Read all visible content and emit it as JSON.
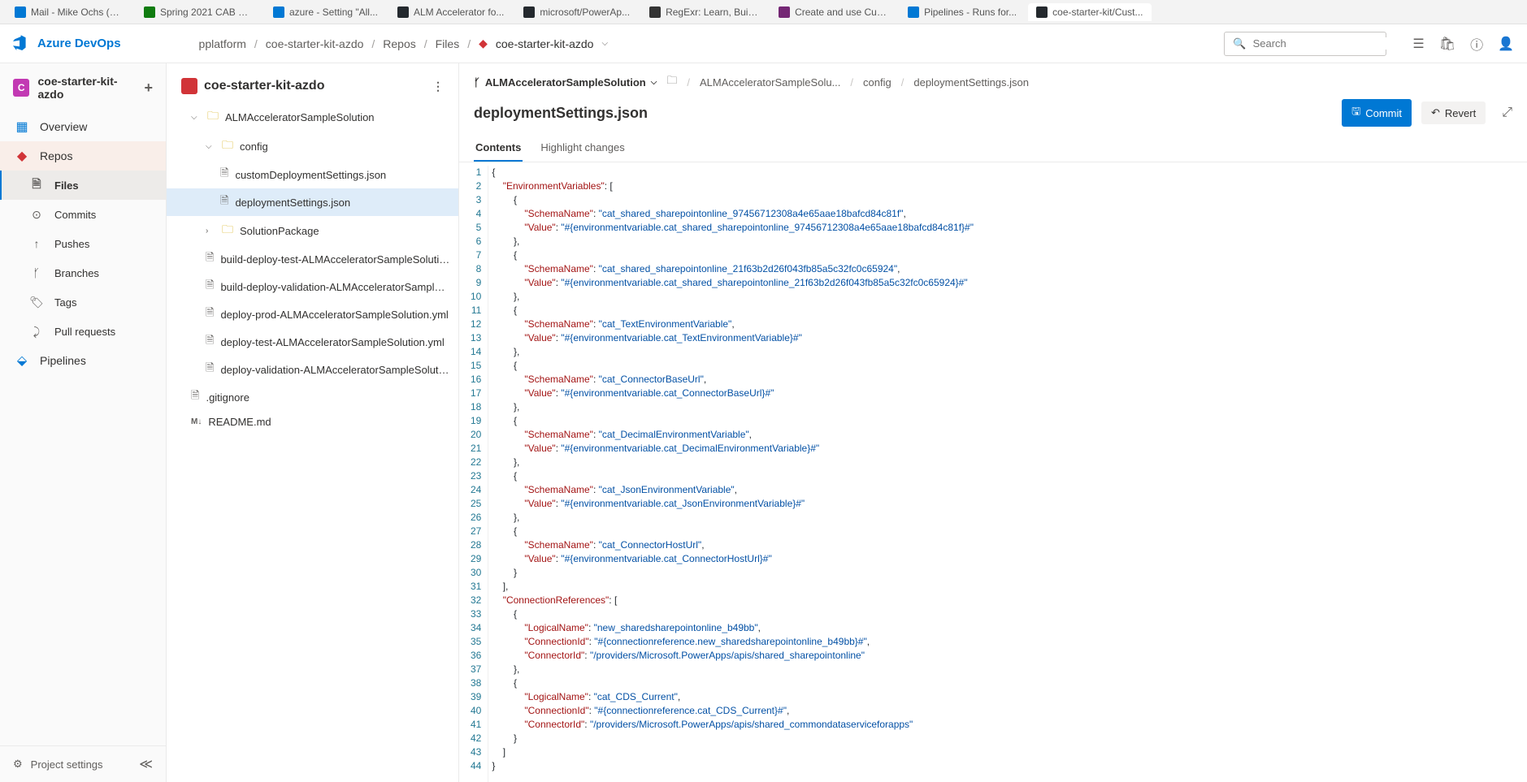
{
  "browser_tabs": [
    {
      "label": "Mail - Mike Ochs (C...",
      "favicon": "#0078d4"
    },
    {
      "label": "Spring 2021 CAB Se...",
      "favicon": "#107c10"
    },
    {
      "label": "azure - Setting \"All...",
      "favicon": "#0078d4"
    },
    {
      "label": "ALM Accelerator fo...",
      "favicon": "#24292e"
    },
    {
      "label": "microsoft/PowerAp...",
      "favicon": "#24292e"
    },
    {
      "label": "RegExr: Learn, Build...",
      "favicon": "#333"
    },
    {
      "label": "Create and use Cus...",
      "favicon": "#742774"
    },
    {
      "label": "Pipelines - Runs for...",
      "favicon": "#0078d4"
    },
    {
      "label": "coe-starter-kit/Cust...",
      "favicon": "#24292e"
    }
  ],
  "product": "Azure DevOps",
  "breadcrumbs": {
    "org": "pplatform",
    "project": "coe-starter-kit-azdo",
    "hub": "Repos",
    "sub": "Files",
    "repo": "coe-starter-kit-azdo"
  },
  "search_placeholder": "Search",
  "left_nav": {
    "project": "coe-starter-kit-azdo",
    "project_initial": "C",
    "items": [
      {
        "label": "Overview",
        "icon": "◧",
        "class": "overview"
      },
      {
        "label": "Repos",
        "icon": "◆",
        "class": "repos"
      }
    ],
    "sub_items": [
      {
        "label": "Files",
        "selected": true
      },
      {
        "label": "Commits"
      },
      {
        "label": "Pushes"
      },
      {
        "label": "Branches"
      },
      {
        "label": "Tags"
      },
      {
        "label": "Pull requests"
      }
    ],
    "pipelines": "Pipelines",
    "footer": "Project settings"
  },
  "tree": {
    "repo": "coe-starter-kit-azdo",
    "root_folder": "ALMAcceleratorSampleSolution",
    "sub_folder": "config",
    "files_in_config": [
      "customDeploymentSettings.json",
      "deploymentSettings.json"
    ],
    "solution_pkg": "SolutionPackage",
    "root_files": [
      "build-deploy-test-ALMAcceleratorSampleSolutio...",
      "build-deploy-validation-ALMAcceleratorSampleS...",
      "deploy-prod-ALMAcceleratorSampleSolution.yml",
      "deploy-test-ALMAcceleratorSampleSolution.yml",
      "deploy-validation-ALMAcceleratorSampleSolutio..."
    ],
    "gitignore": ".gitignore",
    "readme": "README.md",
    "readme_prefix": "M↓"
  },
  "file_bc": {
    "branch": "ALMAcceleratorSampleSolution",
    "path": [
      "ALMAcceleratorSampleSolu...",
      "config",
      "deploymentSettings.json"
    ]
  },
  "file_title": "deploymentSettings.json",
  "commit_btn": "Commit",
  "revert_btn": "Revert",
  "tabs": {
    "contents": "Contents",
    "highlight": "Highlight changes"
  },
  "code_lines": [
    [
      {
        "t": "p",
        "v": "{"
      }
    ],
    [
      {
        "t": "p",
        "v": "    "
      },
      {
        "t": "k",
        "v": "\"EnvironmentVariables\""
      },
      {
        "t": "p",
        "v": ": ["
      }
    ],
    [
      {
        "t": "p",
        "v": "        {"
      }
    ],
    [
      {
        "t": "p",
        "v": "            "
      },
      {
        "t": "k",
        "v": "\"SchemaName\""
      },
      {
        "t": "p",
        "v": ": "
      },
      {
        "t": "s",
        "v": "\"cat_shared_sharepointonline_97456712308a4e65aae18bafcd84c81f\""
      },
      {
        "t": "p",
        "v": ","
      }
    ],
    [
      {
        "t": "p",
        "v": "            "
      },
      {
        "t": "k",
        "v": "\"Value\""
      },
      {
        "t": "p",
        "v": ": "
      },
      {
        "t": "s",
        "v": "\"#{environmentvariable.cat_shared_sharepointonline_97456712308a4e65aae18bafcd84c81f}#\""
      }
    ],
    [
      {
        "t": "p",
        "v": "        },"
      }
    ],
    [
      {
        "t": "p",
        "v": "        {"
      }
    ],
    [
      {
        "t": "p",
        "v": "            "
      },
      {
        "t": "k",
        "v": "\"SchemaName\""
      },
      {
        "t": "p",
        "v": ": "
      },
      {
        "t": "s",
        "v": "\"cat_shared_sharepointonline_21f63b2d26f043fb85a5c32fc0c65924\""
      },
      {
        "t": "p",
        "v": ","
      }
    ],
    [
      {
        "t": "p",
        "v": "            "
      },
      {
        "t": "k",
        "v": "\"Value\""
      },
      {
        "t": "p",
        "v": ": "
      },
      {
        "t": "s",
        "v": "\"#{environmentvariable.cat_shared_sharepointonline_21f63b2d26f043fb85a5c32fc0c65924}#\""
      }
    ],
    [
      {
        "t": "p",
        "v": "        },"
      }
    ],
    [
      {
        "t": "p",
        "v": "        {"
      }
    ],
    [
      {
        "t": "p",
        "v": "            "
      },
      {
        "t": "k",
        "v": "\"SchemaName\""
      },
      {
        "t": "p",
        "v": ": "
      },
      {
        "t": "s",
        "v": "\"cat_TextEnvironmentVariable\""
      },
      {
        "t": "p",
        "v": ","
      }
    ],
    [
      {
        "t": "p",
        "v": "            "
      },
      {
        "t": "k",
        "v": "\"Value\""
      },
      {
        "t": "p",
        "v": ": "
      },
      {
        "t": "s",
        "v": "\"#{environmentvariable.cat_TextEnvironmentVariable}#\""
      }
    ],
    [
      {
        "t": "p",
        "v": "        },"
      }
    ],
    [
      {
        "t": "p",
        "v": "        {"
      }
    ],
    [
      {
        "t": "p",
        "v": "            "
      },
      {
        "t": "k",
        "v": "\"SchemaName\""
      },
      {
        "t": "p",
        "v": ": "
      },
      {
        "t": "s",
        "v": "\"cat_ConnectorBaseUrl\""
      },
      {
        "t": "p",
        "v": ","
      }
    ],
    [
      {
        "t": "p",
        "v": "            "
      },
      {
        "t": "k",
        "v": "\"Value\""
      },
      {
        "t": "p",
        "v": ": "
      },
      {
        "t": "s",
        "v": "\"#{environmentvariable.cat_ConnectorBaseUrl}#\""
      }
    ],
    [
      {
        "t": "p",
        "v": "        },"
      }
    ],
    [
      {
        "t": "p",
        "v": "        {"
      }
    ],
    [
      {
        "t": "p",
        "v": "            "
      },
      {
        "t": "k",
        "v": "\"SchemaName\""
      },
      {
        "t": "p",
        "v": ": "
      },
      {
        "t": "s",
        "v": "\"cat_DecimalEnvironmentVariable\""
      },
      {
        "t": "p",
        "v": ","
      }
    ],
    [
      {
        "t": "p",
        "v": "            "
      },
      {
        "t": "k",
        "v": "\"Value\""
      },
      {
        "t": "p",
        "v": ": "
      },
      {
        "t": "s",
        "v": "\"#{environmentvariable.cat_DecimalEnvironmentVariable}#\""
      }
    ],
    [
      {
        "t": "p",
        "v": "        },"
      }
    ],
    [
      {
        "t": "p",
        "v": "        {"
      }
    ],
    [
      {
        "t": "p",
        "v": "            "
      },
      {
        "t": "k",
        "v": "\"SchemaName\""
      },
      {
        "t": "p",
        "v": ": "
      },
      {
        "t": "s",
        "v": "\"cat_JsonEnvironmentVariable\""
      },
      {
        "t": "p",
        "v": ","
      }
    ],
    [
      {
        "t": "p",
        "v": "            "
      },
      {
        "t": "k",
        "v": "\"Value\""
      },
      {
        "t": "p",
        "v": ": "
      },
      {
        "t": "s",
        "v": "\"#{environmentvariable.cat_JsonEnvironmentVariable}#\""
      }
    ],
    [
      {
        "t": "p",
        "v": "        },"
      }
    ],
    [
      {
        "t": "p",
        "v": "        {"
      }
    ],
    [
      {
        "t": "p",
        "v": "            "
      },
      {
        "t": "k",
        "v": "\"SchemaName\""
      },
      {
        "t": "p",
        "v": ": "
      },
      {
        "t": "s",
        "v": "\"cat_ConnectorHostUrl\""
      },
      {
        "t": "p",
        "v": ","
      }
    ],
    [
      {
        "t": "p",
        "v": "            "
      },
      {
        "t": "k",
        "v": "\"Value\""
      },
      {
        "t": "p",
        "v": ": "
      },
      {
        "t": "s",
        "v": "\"#{environmentvariable.cat_ConnectorHostUrl}#\""
      }
    ],
    [
      {
        "t": "p",
        "v": "        }"
      }
    ],
    [
      {
        "t": "p",
        "v": "    ],"
      }
    ],
    [
      {
        "t": "p",
        "v": "    "
      },
      {
        "t": "k",
        "v": "\"ConnectionReferences\""
      },
      {
        "t": "p",
        "v": ": ["
      }
    ],
    [
      {
        "t": "p",
        "v": "        {"
      }
    ],
    [
      {
        "t": "p",
        "v": "            "
      },
      {
        "t": "k",
        "v": "\"LogicalName\""
      },
      {
        "t": "p",
        "v": ": "
      },
      {
        "t": "s",
        "v": "\"new_sharedsharepointonline_b49bb\""
      },
      {
        "t": "p",
        "v": ","
      }
    ],
    [
      {
        "t": "p",
        "v": "            "
      },
      {
        "t": "k",
        "v": "\"ConnectionId\""
      },
      {
        "t": "p",
        "v": ": "
      },
      {
        "t": "s",
        "v": "\"#{connectionreference.new_sharedsharepointonline_b49bb}#\""
      },
      {
        "t": "p",
        "v": ","
      }
    ],
    [
      {
        "t": "p",
        "v": "            "
      },
      {
        "t": "k",
        "v": "\"ConnectorId\""
      },
      {
        "t": "p",
        "v": ": "
      },
      {
        "t": "s",
        "v": "\"/providers/Microsoft.PowerApps/apis/shared_sharepointonline\""
      }
    ],
    [
      {
        "t": "p",
        "v": "        },"
      }
    ],
    [
      {
        "t": "p",
        "v": "        {"
      }
    ],
    [
      {
        "t": "p",
        "v": "            "
      },
      {
        "t": "k",
        "v": "\"LogicalName\""
      },
      {
        "t": "p",
        "v": ": "
      },
      {
        "t": "s",
        "v": "\"cat_CDS_Current\""
      },
      {
        "t": "p",
        "v": ","
      }
    ],
    [
      {
        "t": "p",
        "v": "            "
      },
      {
        "t": "k",
        "v": "\"ConnectionId\""
      },
      {
        "t": "p",
        "v": ": "
      },
      {
        "t": "s",
        "v": "\"#{connectionreference.cat_CDS_Current}#\""
      },
      {
        "t": "p",
        "v": ","
      }
    ],
    [
      {
        "t": "p",
        "v": "            "
      },
      {
        "t": "k",
        "v": "\"ConnectorId\""
      },
      {
        "t": "p",
        "v": ": "
      },
      {
        "t": "s",
        "v": "\"/providers/Microsoft.PowerApps/apis/shared_commondataserviceforapps\""
      }
    ],
    [
      {
        "t": "p",
        "v": "        }"
      }
    ],
    [
      {
        "t": "p",
        "v": "    ]"
      }
    ],
    [
      {
        "t": "p",
        "v": "}"
      }
    ]
  ]
}
